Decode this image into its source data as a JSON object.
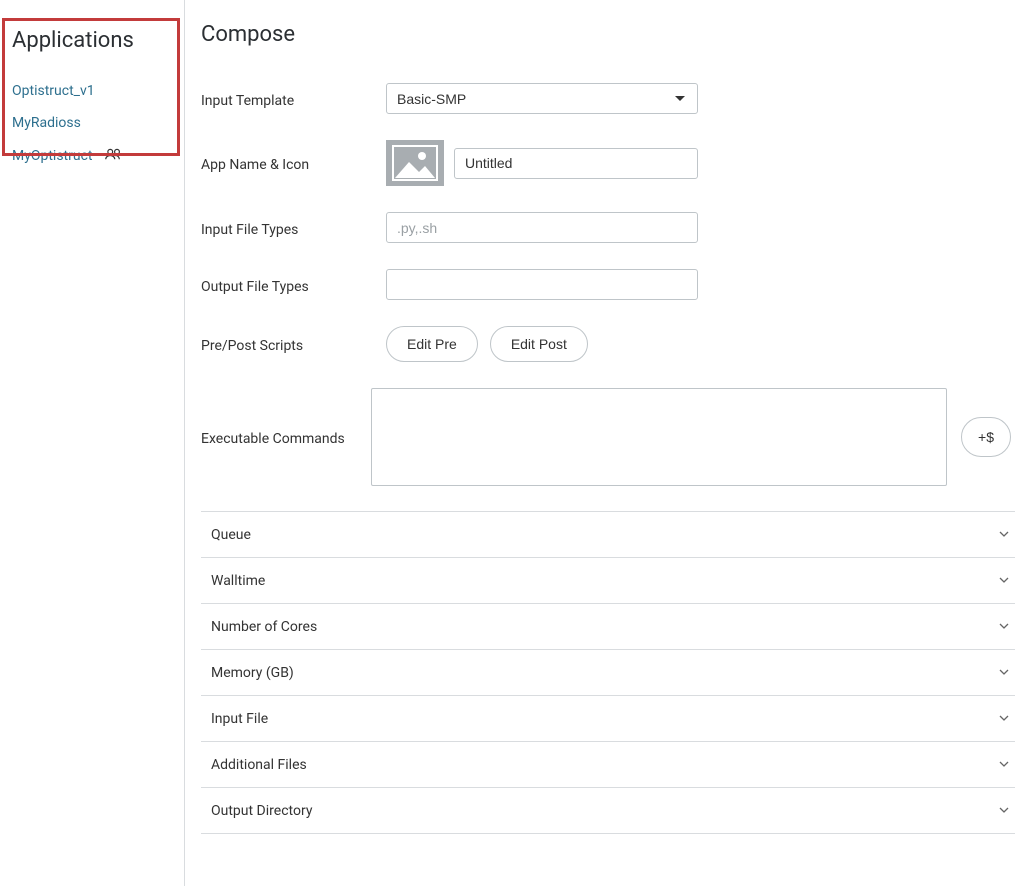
{
  "sidebar": {
    "title": "Applications",
    "items": [
      {
        "label": "Optistruct_v1",
        "shared": false
      },
      {
        "label": "MyRadioss",
        "shared": false
      },
      {
        "label": "MyOptistruct",
        "shared": true
      }
    ]
  },
  "main": {
    "title": "Compose",
    "input_template": {
      "label": "Input Template",
      "value": "Basic-SMP"
    },
    "app_name_icon": {
      "label": "App Name & Icon",
      "value": "Untitled"
    },
    "input_file_types": {
      "label": "Input File Types",
      "placeholder": ".py,.sh",
      "value": ""
    },
    "output_file_types": {
      "label": "Output File Types",
      "value": ""
    },
    "scripts": {
      "label": "Pre/Post Scripts",
      "edit_pre": "Edit Pre",
      "edit_post": "Edit Post"
    },
    "exec": {
      "label": "Executable Commands",
      "value": "",
      "add_var": "+$"
    },
    "accordion": [
      {
        "label": "Queue"
      },
      {
        "label": "Walltime"
      },
      {
        "label": "Number of Cores"
      },
      {
        "label": "Memory (GB)"
      },
      {
        "label": "Input File"
      },
      {
        "label": "Additional Files"
      },
      {
        "label": "Output Directory"
      }
    ]
  }
}
